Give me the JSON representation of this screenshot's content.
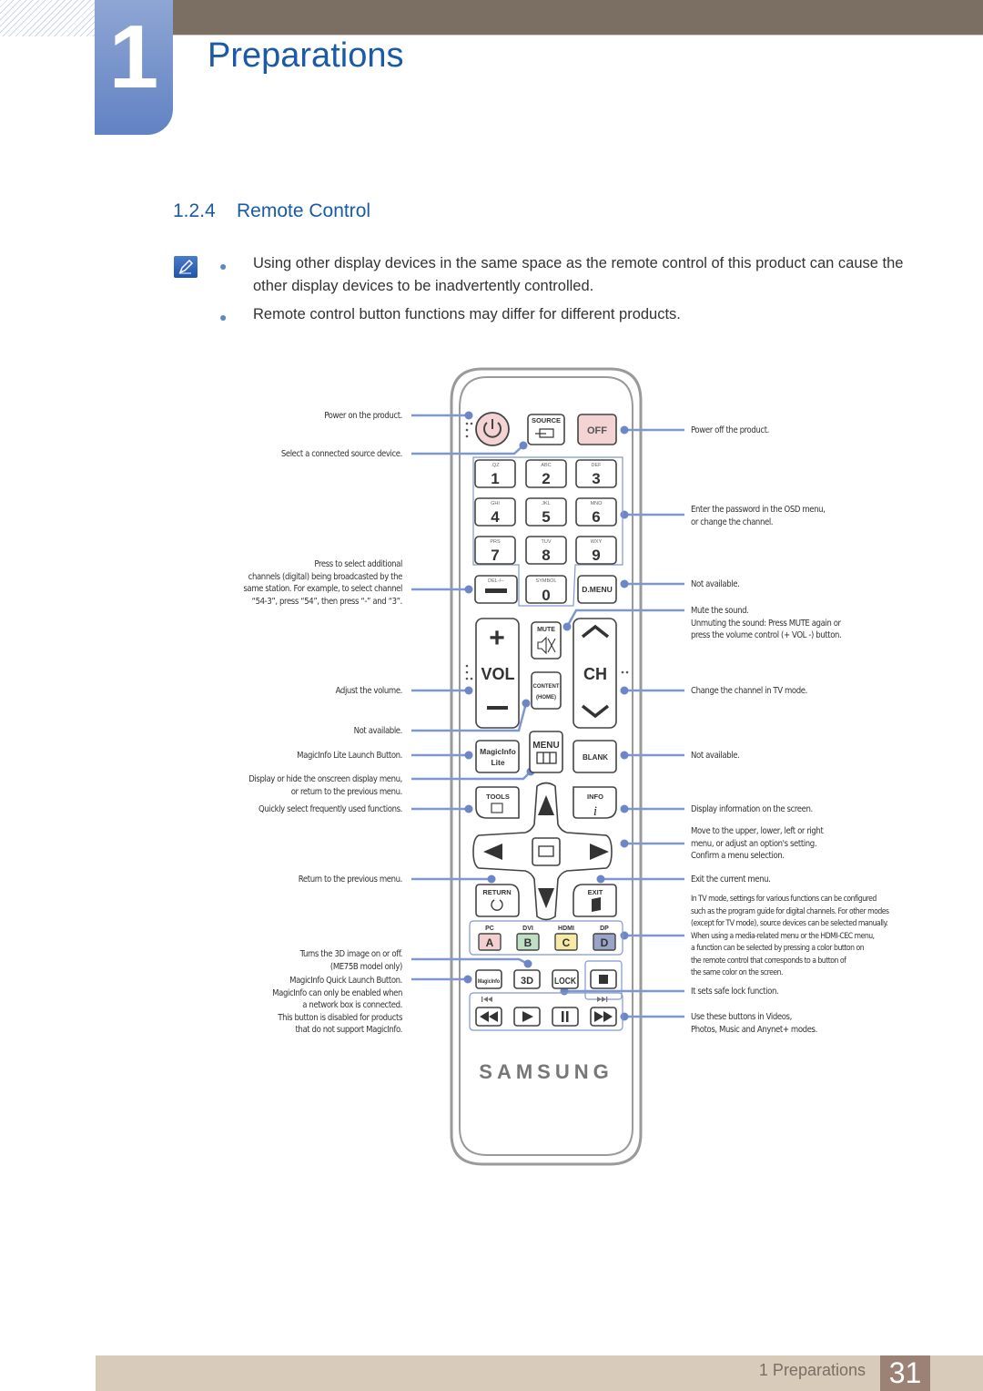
{
  "header": {
    "chapter_number": "1",
    "chapter_title": "Preparations"
  },
  "section": {
    "number": "1.2.4",
    "title": "Remote Control"
  },
  "notes": [
    "Using other display devices in the same space as the remote control of this product can cause the other display devices to be inadvertently controlled.",
    "Remote control button functions may differ for different products."
  ],
  "remote": {
    "buttons": {
      "source": "SOURCE",
      "off": "OFF",
      "keys": [
        {
          "letters": ".QZ",
          "digit": "1"
        },
        {
          "letters": "ABC",
          "digit": "2"
        },
        {
          "letters": "DEF",
          "digit": "3"
        },
        {
          "letters": "GHI",
          "digit": "4"
        },
        {
          "letters": "JKL",
          "digit": "5"
        },
        {
          "letters": "MNO",
          "digit": "6"
        },
        {
          "letters": "PRS",
          "digit": "7"
        },
        {
          "letters": "TUV",
          "digit": "8"
        },
        {
          "letters": "WXY",
          "digit": "9"
        }
      ],
      "del": "DEL-/--",
      "symbol": "SYMBOL",
      "zero": "0",
      "dmenu": "D.MENU",
      "mute": "MUTE",
      "vol": "VOL",
      "ch": "CH",
      "content1": "CONTENT",
      "content2": "(HOME)",
      "magicinfo_lite1": "MagicInfo",
      "magicinfo_lite2": "Lite",
      "menu": "MENU",
      "blank": "BLANK",
      "tools": "TOOLS",
      "info": "INFO",
      "return": "RETURN",
      "exit": "EXIT",
      "color_labels": [
        "PC",
        "DVI",
        "HDMI",
        "DP"
      ],
      "color_keys": [
        "A",
        "B",
        "C",
        "D"
      ],
      "magicinfo": "MagicInfo",
      "three_d": "3D",
      "lock": "LOCK",
      "brand": "SAMSUNG"
    },
    "colors": {
      "power": "#f3d3d3",
      "a": "#f3d0d0",
      "b": "#bfe0c4",
      "c": "#f6eaa6",
      "d": "#9aa4c8",
      "callout": "#7f97cf"
    }
  },
  "callouts_left": [
    "Power on the product.",
    "Select a connected source device.",
    "Press to select additional\nchannels (digital) being broadcasted by the\nsame station. For example, to select channel\n“54-3”, press “54”, then press “-” and “3”.",
    "Adjust the volume.",
    "Not available.",
    "MagicInfo Lite Launch Button.",
    "Display or hide the onscreen display menu,\nor return to the previous menu.",
    "Quickly select frequently used functions.",
    "Return to the previous menu.",
    "Turns the 3D image on or off.\n(ME75B model only)",
    "MagicInfo Quick Launch Button.\nMagicInfo can only be enabled when\na network box is connected.\nThis button is disabled for products\nthat do not support MagicInfo."
  ],
  "callouts_right": [
    "Power off the product.",
    "Enter the password in the OSD menu,\nor change the channel.",
    "Not available.",
    "Mute the sound.\nUnmuting the sound: Press MUTE again or\npress the volume control (+  VOL  -) button.",
    "Change the channel in TV mode.",
    "Not available.",
    "Display information on the screen.",
    "Move to the upper, lower, left or right\nmenu, or adjust an option's setting.\nConfirm a menu selection.",
    "Exit the current menu.",
    "In TV mode, settings for various functions can be configured\nsuch as the program guide for digital channels. For other modes\n(except for TV mode), source devices can be selected manually.\nWhen using a media-related menu or the HDMI-CEC menu,\na function can be selected by pressing a color button on\nthe remote control that corresponds to a button of\nthe same color on the screen.",
    "It sets safe lock function.",
    "Use these buttons in Videos,\nPhotos, Music and Anynet+ modes."
  ],
  "footer": {
    "label": "1 Preparations",
    "page": "31"
  }
}
